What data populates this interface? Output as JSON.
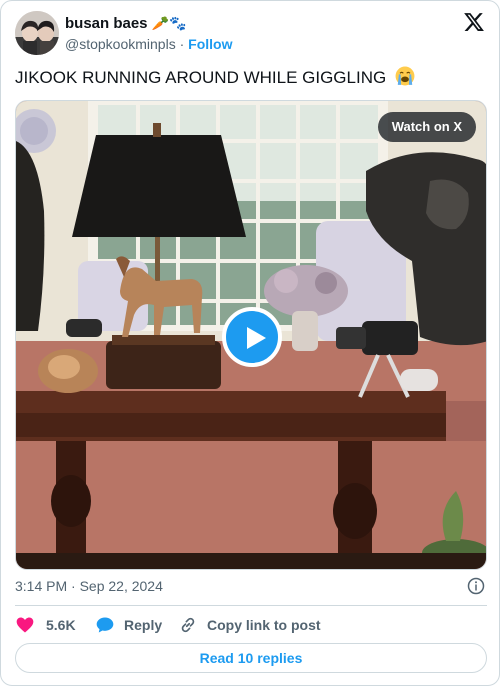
{
  "author": {
    "display_name": "busan baes",
    "name_emojis": "🥕🐾",
    "handle": "@stopkookminpls",
    "separator": "·",
    "follow_label": "Follow"
  },
  "tweet": {
    "text": "JIKOOK RUNNING AROUND WHILE GIGGLING",
    "emoji": "loudly-crying-face"
  },
  "media": {
    "type": "video",
    "watch_label": "Watch on X"
  },
  "meta": {
    "timestamp": "3:14 PM · Sep 22, 2024"
  },
  "actions": {
    "like_count": "5.6K",
    "reply_label": "Reply",
    "copy_label": "Copy link to post"
  },
  "read_replies_label": "Read 10 replies",
  "colors": {
    "accent": "#1d9bf0",
    "like": "#f91880",
    "text": "#0f1419",
    "secondary": "#536471",
    "border": "#cfd9de"
  }
}
